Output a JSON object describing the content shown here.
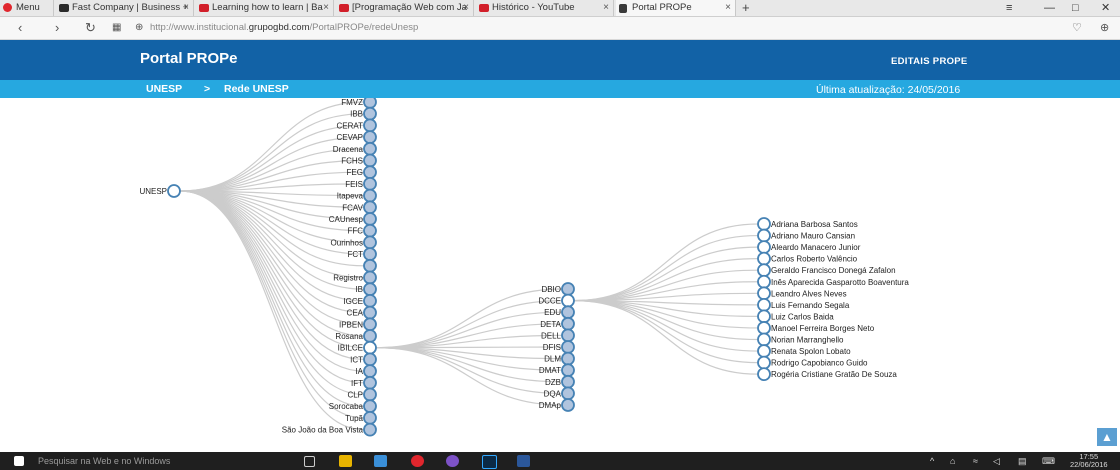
{
  "browser": {
    "menu_label": "Menu",
    "tabs": [
      {
        "label": "Fast Company | Business +",
        "favicon_color": "#2b2b2b"
      },
      {
        "label": "Learning how to learn | Ba",
        "favicon_color": "#d21f2a"
      },
      {
        "label": "[Programação Web com Ja",
        "favicon_color": "#d21f2a"
      },
      {
        "label": "Histórico - YouTube",
        "favicon_color": "#d21f2a"
      },
      {
        "label": "Portal PROPe",
        "favicon_color": "#3a3a3a"
      }
    ],
    "new_tab_glyph": "+",
    "url_prefix": "http://www.institucional.",
    "url_domain": "grupogbd.com",
    "url_path": "/PortalPROPe/redeUnesp"
  },
  "site": {
    "brand": "Portal PROPe",
    "nav_editais": "EDITAIS PROPE",
    "breadcrumb": {
      "home": "UNESP",
      "separator": ">",
      "current": "Rede UNESP"
    },
    "last_updated": "Última atualização: 24/05/2016",
    "colors": {
      "header": "#1262a6",
      "subbar": "#26a8e0",
      "node_filled": "#b0c4de",
      "node_stroke": "#4682b4",
      "link": "#cccccc"
    }
  },
  "tree": {
    "root": {
      "label": "UNESP",
      "filled": false
    },
    "units": [
      {
        "label": "FMVZ",
        "filled": true
      },
      {
        "label": "IBB",
        "filled": true
      },
      {
        "label": "CERAT",
        "filled": true
      },
      {
        "label": "CEVAP",
        "filled": true
      },
      {
        "label": "Dracena",
        "filled": true
      },
      {
        "label": "FCHS",
        "filled": true
      },
      {
        "label": "FEG",
        "filled": true
      },
      {
        "label": "FEIS",
        "filled": true
      },
      {
        "label": "Itapeva",
        "filled": true
      },
      {
        "label": "FCAV",
        "filled": true
      },
      {
        "label": "CAUnesp",
        "filled": true
      },
      {
        "label": "FFC",
        "filled": true
      },
      {
        "label": "Ourinhos",
        "filled": true
      },
      {
        "label": "FCT",
        "filled": true
      },
      {
        "label": "",
        "filled": true
      },
      {
        "label": "Registro",
        "filled": true
      },
      {
        "label": "IB",
        "filled": true
      },
      {
        "label": "IGCE",
        "filled": true
      },
      {
        "label": "CEA",
        "filled": true
      },
      {
        "label": "IPBEN",
        "filled": true
      },
      {
        "label": "Rosana",
        "filled": true
      },
      {
        "label": "IBILCE",
        "filled": false
      },
      {
        "label": "ICT",
        "filled": true
      },
      {
        "label": "IA",
        "filled": true
      },
      {
        "label": "IFT",
        "filled": true
      },
      {
        "label": "CLP",
        "filled": true
      },
      {
        "label": "Sorocaba",
        "filled": true
      },
      {
        "label": "Tupã",
        "filled": true
      },
      {
        "label": "São João da Boa Vista",
        "filled": true
      }
    ],
    "departments": [
      {
        "label": "DBIO",
        "filled": true
      },
      {
        "label": "DCCE",
        "filled": false
      },
      {
        "label": "EDU",
        "filled": true
      },
      {
        "label": "DETA",
        "filled": true
      },
      {
        "label": "DELL",
        "filled": true
      },
      {
        "label": "DFIS",
        "filled": true
      },
      {
        "label": "DLM",
        "filled": true
      },
      {
        "label": "DMAT",
        "filled": true
      },
      {
        "label": "DZB",
        "filled": true
      },
      {
        "label": "DQA",
        "filled": true
      },
      {
        "label": "DMAp",
        "filled": true
      }
    ],
    "people": [
      "Adriana Barbosa Santos",
      "Adriano Mauro Cansian",
      "Aleardo Manacero Junior",
      "Carlos Roberto Valêncio",
      "Geraldo Francisco Donegá Zafalon",
      "Inês Aparecida Gasparotto Boaventura",
      "Leandro Alves Neves",
      "Luis Fernando Segala",
      "Luiz Carlos Baida",
      "Manoel Ferreira Borges Neto",
      "Norian Marranghello",
      "Renata Spolon Lobato",
      "Rodrigo Capobianco Guido",
      "Rogéria Cristiane Gratão De Souza"
    ]
  },
  "taskbar": {
    "search_placeholder": "Pesquisar na Web e no Windows",
    "time": "17:55",
    "date": "22/06/2016"
  }
}
